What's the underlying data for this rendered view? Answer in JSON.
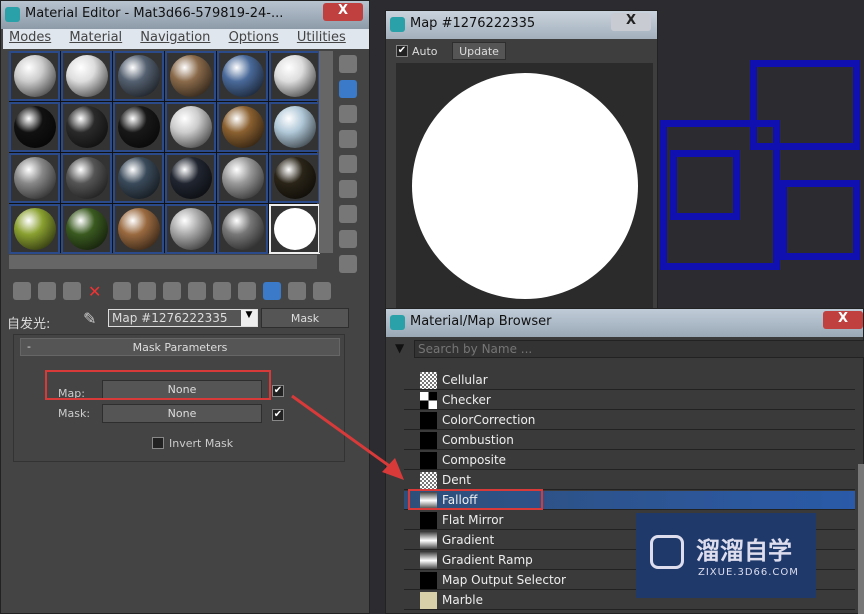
{
  "material_editor": {
    "title": "Material Editor - Mat3d66-579819-24-...",
    "menu": [
      "Modes",
      "Material",
      "Navigation",
      "Options",
      "Utilities"
    ],
    "slot_colors": [
      "#ccc",
      "#ddd",
      "#546070",
      "#8a6a4a",
      "#4a6a9a",
      "#ddd",
      "#111",
      "#2a2a2a",
      "#181818",
      "#ccc",
      "#8a6030",
      "#b0c8d8",
      "#888",
      "#555",
      "#3a4a5a",
      "#202530",
      "#999",
      "#2a2418",
      "#8aa030",
      "#3a5a20",
      "#9a6a40",
      "#aaa",
      "#777",
      "#ffffff"
    ],
    "name_label": "自发光:",
    "map_name": "Map #1276222335",
    "type_button": "Mask",
    "rollout_toggle": "-",
    "rollout_title": "Mask Parameters",
    "map_label": "Map:",
    "map_value": "None",
    "mask_label": "Mask:",
    "mask_value": "None",
    "invert_label": "Invert Mask",
    "close": "X"
  },
  "map_window": {
    "title": "Map #1276222335",
    "auto_label": "Auto",
    "update_label": "Update",
    "close": "X"
  },
  "browser": {
    "title": "Material/Map Browser",
    "search_placeholder": "Search by Name ...",
    "items": [
      {
        "label": "Cellular",
        "swatch": "noise"
      },
      {
        "label": "Checker",
        "swatch": "checker"
      },
      {
        "label": "ColorCorrection",
        "swatch": "black"
      },
      {
        "label": "Combustion",
        "swatch": "black"
      },
      {
        "label": "Composite",
        "swatch": "black"
      },
      {
        "label": "Dent",
        "swatch": "noise"
      },
      {
        "label": "Falloff",
        "swatch": "gradient",
        "selected": true
      },
      {
        "label": "Flat Mirror",
        "swatch": "black"
      },
      {
        "label": "Gradient",
        "swatch": "gradient"
      },
      {
        "label": "Gradient Ramp",
        "swatch": "gradient"
      },
      {
        "label": "Map Output Selector",
        "swatch": "black"
      },
      {
        "label": "Marble",
        "swatch": "marble"
      }
    ],
    "close": "X"
  },
  "watermark": {
    "title": "溜溜自学",
    "url": "ZIXUE.3D66.COM"
  },
  "colors": {
    "highlight": "#d83a3a",
    "selection": "#2a5aa8"
  }
}
